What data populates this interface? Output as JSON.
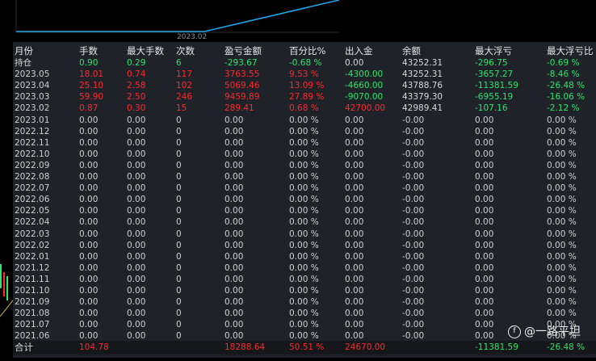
{
  "chart": {
    "x_label": "2023.02",
    "line_color": "#1fa3e6"
  },
  "table": {
    "headers": [
      "月份",
      "手数",
      "最大手数",
      "次数",
      "盈亏金额",
      "百分比%",
      "出入金",
      "余额",
      "最大浮亏",
      "最大浮亏比"
    ],
    "rows": [
      {
        "c": [
          "持仓",
          "0.90",
          "0.29",
          "6",
          "-293.67",
          "-0.68 %",
          "0.00",
          "43252.31",
          "-296.75",
          "-0.69 %"
        ],
        "k": [
          "w",
          "g",
          "g",
          "g",
          "g",
          "g",
          "w",
          "w",
          "g",
          "g"
        ]
      },
      {
        "c": [
          "2023.05",
          "18.01",
          "0.74",
          "117",
          "3763.55",
          "9.53 %",
          "-4300.00",
          "43252.31",
          "-3657.27",
          "-8.46 %"
        ],
        "k": [
          "gy",
          "r",
          "r",
          "r",
          "r",
          "r",
          "g",
          "w",
          "g",
          "g"
        ]
      },
      {
        "c": [
          "2023.04",
          "25.10",
          "2.58",
          "102",
          "5069.46",
          "13.09 %",
          "-4660.00",
          "43788.76",
          "-11381.59",
          "-26.48 %"
        ],
        "k": [
          "gy",
          "r",
          "r",
          "r",
          "r",
          "r",
          "g",
          "w",
          "g",
          "g"
        ]
      },
      {
        "c": [
          "2023.03",
          "59.90",
          "2.50",
          "246",
          "9459.89",
          "27.89 %",
          "-9070.00",
          "43379.30",
          "-6955.19",
          "-16.06 %"
        ],
        "k": [
          "gy",
          "r",
          "r",
          "r",
          "r",
          "r",
          "g",
          "w",
          "g",
          "g"
        ]
      },
      {
        "c": [
          "2023.02",
          "0.87",
          "0.30",
          "15",
          "289.41",
          "0.68 %",
          "42700.00",
          "42989.41",
          "-107.16",
          "-2.12 %"
        ],
        "k": [
          "gy",
          "r",
          "r",
          "r",
          "r",
          "r",
          "r",
          "w",
          "g",
          "g"
        ]
      },
      {
        "c": [
          "2023.01",
          "0.00",
          "0.00",
          "0",
          "0.00",
          "0.00 %",
          "0.00",
          "-0.00",
          "0.00",
          "0.00 %"
        ],
        "k": "zero"
      },
      {
        "c": [
          "2022.12",
          "0.00",
          "0.00",
          "0",
          "0.00",
          "0.00 %",
          "0.00",
          "-0.00",
          "0.00",
          "0.00 %"
        ],
        "k": "zero"
      },
      {
        "c": [
          "2022.11",
          "0.00",
          "0.00",
          "0",
          "0.00",
          "0.00 %",
          "0.00",
          "-0.00",
          "0.00",
          "0.00 %"
        ],
        "k": "zero"
      },
      {
        "c": [
          "2022.10",
          "0.00",
          "0.00",
          "0",
          "0.00",
          "0.00 %",
          "0.00",
          "-0.00",
          "0.00",
          "0.00 %"
        ],
        "k": "zero"
      },
      {
        "c": [
          "2022.09",
          "0.00",
          "0.00",
          "0",
          "0.00",
          "0.00 %",
          "0.00",
          "-0.00",
          "0.00",
          "0.00 %"
        ],
        "k": "zero"
      },
      {
        "c": [
          "2022.08",
          "0.00",
          "0.00",
          "0",
          "0.00",
          "0.00 %",
          "0.00",
          "-0.00",
          "0.00",
          "0.00 %"
        ],
        "k": "zero"
      },
      {
        "c": [
          "2022.07",
          "0.00",
          "0.00",
          "0",
          "0.00",
          "0.00 %",
          "0.00",
          "-0.00",
          "0.00",
          "0.00 %"
        ],
        "k": "zero"
      },
      {
        "c": [
          "2022.06",
          "0.00",
          "0.00",
          "0",
          "0.00",
          "0.00 %",
          "0.00",
          "-0.00",
          "0.00",
          "0.00 %"
        ],
        "k": "zero"
      },
      {
        "c": [
          "2022.05",
          "0.00",
          "0.00",
          "0",
          "0.00",
          "0.00 %",
          "0.00",
          "-0.00",
          "0.00",
          "0.00 %"
        ],
        "k": "zero"
      },
      {
        "c": [
          "2022.04",
          "0.00",
          "0.00",
          "0",
          "0.00",
          "0.00 %",
          "0.00",
          "-0.00",
          "0.00",
          "0.00 %"
        ],
        "k": "zero"
      },
      {
        "c": [
          "2022.03",
          "0.00",
          "0.00",
          "0",
          "0.00",
          "0.00 %",
          "0.00",
          "-0.00",
          "0.00",
          "0.00 %"
        ],
        "k": "zero"
      },
      {
        "c": [
          "2022.02",
          "0.00",
          "0.00",
          "0",
          "0.00",
          "0.00 %",
          "0.00",
          "-0.00",
          "0.00",
          "0.00 %"
        ],
        "k": "zero"
      },
      {
        "c": [
          "2022.01",
          "0.00",
          "0.00",
          "0",
          "0.00",
          "0.00 %",
          "0.00",
          "-0.00",
          "0.00",
          "0.00 %"
        ],
        "k": "zero"
      },
      {
        "c": [
          "2021.12",
          "0.00",
          "0.00",
          "0",
          "0.00",
          "0.00 %",
          "0.00",
          "-0.00",
          "0.00",
          "0.00 %"
        ],
        "k": "zero"
      },
      {
        "c": [
          "2021.11",
          "0.00",
          "0.00",
          "0",
          "0.00",
          "0.00 %",
          "0.00",
          "-0.00",
          "0.00",
          "0.00 %"
        ],
        "k": "zero"
      },
      {
        "c": [
          "2021.10",
          "0.00",
          "0.00",
          "0",
          "0.00",
          "0.00 %",
          "0.00",
          "-0.00",
          "0.00",
          "0.00 %"
        ],
        "k": "zero"
      },
      {
        "c": [
          "2021.09",
          "0.00",
          "0.00",
          "0",
          "0.00",
          "0.00 %",
          "0.00",
          "-0.00",
          "0.00",
          "0.00 %"
        ],
        "k": "zero"
      },
      {
        "c": [
          "2021.08",
          "0.00",
          "0.00",
          "0",
          "0.00",
          "0.00 %",
          "0.00",
          "-0.00",
          "0.00",
          "0.00 %"
        ],
        "k": "zero"
      },
      {
        "c": [
          "2021.07",
          "0.00",
          "0.00",
          "0",
          "0.00",
          "0.00 %",
          "0.00",
          "-0.00",
          "0.00",
          "0.00 %"
        ],
        "k": "zero"
      },
      {
        "c": [
          "2021.06",
          "0.00",
          "0.00",
          "0",
          "0.00",
          "0.00 %",
          "0.00",
          "-0.00",
          "0.00",
          "0.00 %"
        ],
        "k": "zero"
      }
    ],
    "total": {
      "label": "合计",
      "lots": "104.78",
      "profit": "18288.64",
      "percent": "50.51 %",
      "deposit": "24670.00",
      "max_float_loss": "-11381.59",
      "max_float_loss_pct": "-26.48 %"
    }
  },
  "watermark": {
    "icon": "weibo-style-logo-icon",
    "text": "@一路平坦"
  },
  "colors": {
    "positive": "#ff2a2a",
    "negative": "#2ee66b",
    "panel_bg": "#1f2228"
  }
}
